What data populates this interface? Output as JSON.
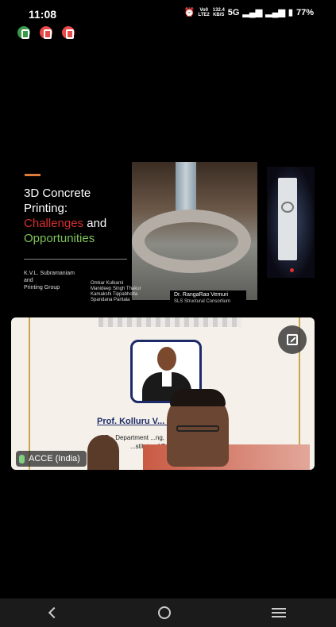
{
  "status_bar": {
    "time": "11:08",
    "volte_top": "Vo0",
    "volte_bottom": "LTE2",
    "speed_top": "132.4",
    "speed_bottom": "KB/S",
    "network": "5G",
    "battery": "77%"
  },
  "notifications": [
    {
      "icon": "chart-app-icon",
      "color": "#3a9a4a"
    },
    {
      "icon": "app-icon-2",
      "color": "#e84a4a"
    },
    {
      "icon": "app-icon-3",
      "color": "#e84a4a"
    }
  ],
  "slide": {
    "title_line1": "3D Concrete",
    "title_line2": "Printing:",
    "title_challenges": "Challenges",
    "title_and": " and",
    "title_opportunities": "Opportunities",
    "author": "K.V.L. Subramaniam",
    "author_and": "and",
    "group": "Printing Group",
    "coauthors": [
      "Omkar Kulkarni",
      "Manideep Singh Thakur",
      "Kamakshi Tippabhotla",
      "Spandana Paritala"
    ],
    "speaker_name": "Dr. RangaRao Vemuri",
    "speaker_org": "SLS Structural Consortium"
  },
  "video_tile": {
    "prof_name": "Prof. Kolluru V... ...iam",
    "prof_sub1": "P... Department ...ng, Indian",
    "prof_sub2": "...stitute of Techi... ...d",
    "participant_label": "ACCE (India)",
    "accent_color": "#c9a64a"
  }
}
